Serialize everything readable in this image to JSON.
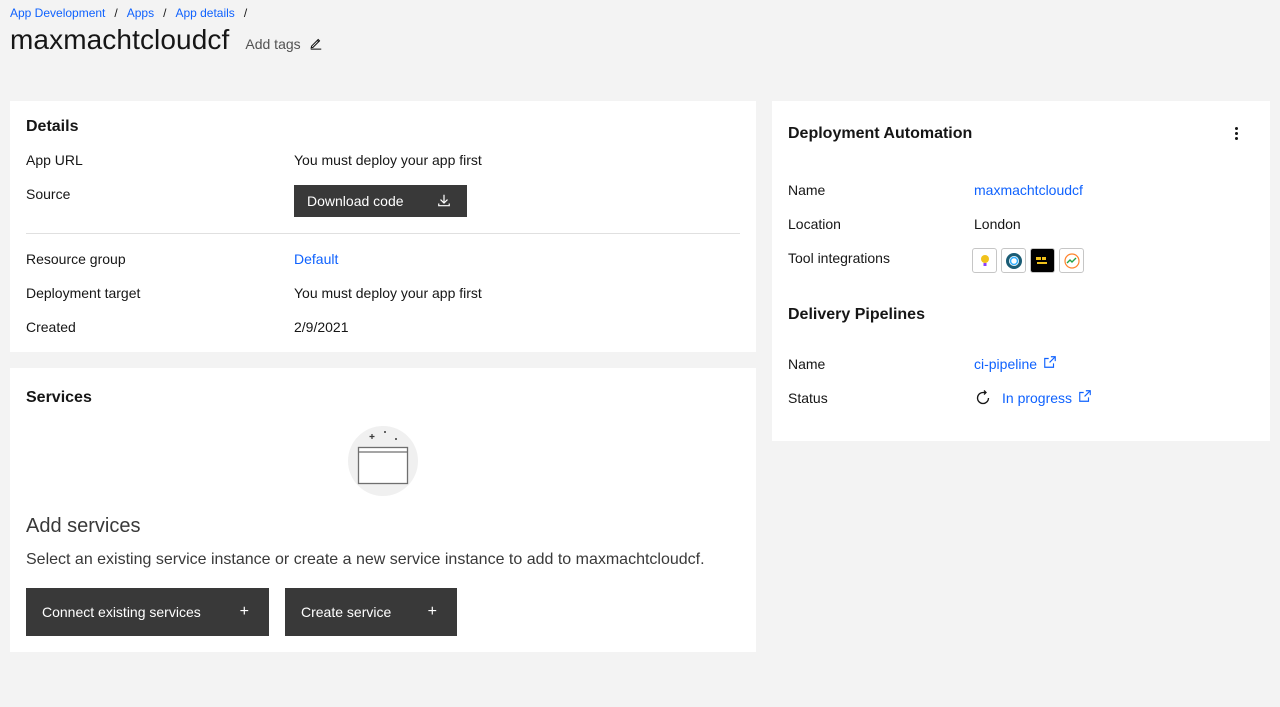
{
  "breadcrumb": {
    "items": [
      "App Development",
      "Apps",
      "App details"
    ],
    "separator": "/"
  },
  "page": {
    "title": "maxmachtcloudcf",
    "add_tags_label": "Add tags"
  },
  "details": {
    "heading": "Details",
    "app_url_label": "App URL",
    "app_url_value": "You must deploy your app first",
    "source_label": "Source",
    "download_button": "Download code",
    "resource_group_label": "Resource group",
    "resource_group_value": "Default",
    "deployment_target_label": "Deployment target",
    "deployment_target_value": "You must deploy your app first",
    "created_label": "Created",
    "created_value": "2/9/2021"
  },
  "services": {
    "heading": "Services",
    "empty_title": "Add services",
    "empty_description": "Select an existing service instance or create a new service instance to add to maxmachtcloudcf.",
    "connect_button": "Connect existing services",
    "create_button": "Create service",
    "button_icon": "+"
  },
  "deployment": {
    "heading": "Deployment Automation",
    "name_label": "Name",
    "name_value": "maxmachtcloudcf",
    "location_label": "Location",
    "location_value": "London",
    "tool_integrations_label": "Tool integrations",
    "tool_icons": [
      "lightbulb-icon",
      "ring-icon",
      "toolchain-icon",
      "devops-insights-icon"
    ]
  },
  "pipelines": {
    "heading": "Delivery Pipelines",
    "name_label": "Name",
    "name_value": "ci-pipeline",
    "status_label": "Status",
    "status_value": "In progress"
  },
  "colors": {
    "link": "#0f62fe",
    "button_dark": "#393939",
    "background": "#f3f3f3",
    "panel": "#ffffff"
  }
}
